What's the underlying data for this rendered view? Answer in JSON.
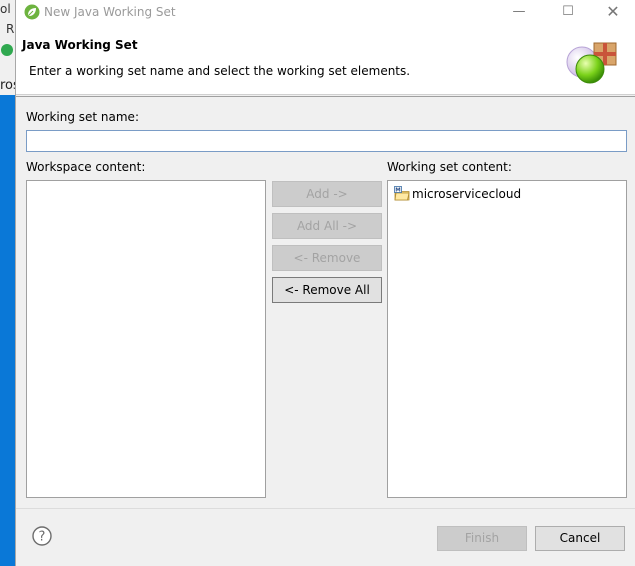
{
  "background": {
    "text_1": "ol",
    "text_2": "R",
    "text_3": "ros"
  },
  "window": {
    "title": "New Java Working Set",
    "minimize_glyph": "—",
    "maximize_glyph": "☐",
    "close_glyph": "✕"
  },
  "banner": {
    "title": "Java Working Set",
    "message": "Enter a working set name and select the working set elements."
  },
  "form": {
    "name_label": "Working set name:",
    "name_value": "",
    "workspace_label": "Workspace content:",
    "set_label": "Working set content:"
  },
  "workspace_items": [],
  "set_items": [
    {
      "label": "microservicecloud",
      "icon": "java-project-icon"
    }
  ],
  "buttons": {
    "add": "Add ->",
    "add_all": "Add All ->",
    "remove": "<- Remove",
    "remove_all": "<- Remove All",
    "finish": "Finish",
    "cancel": "Cancel"
  },
  "colors": {
    "accent_blue": "#0a78d7",
    "dialog_bg": "#f0f0f0",
    "disabled_text": "#a3a3a3"
  }
}
